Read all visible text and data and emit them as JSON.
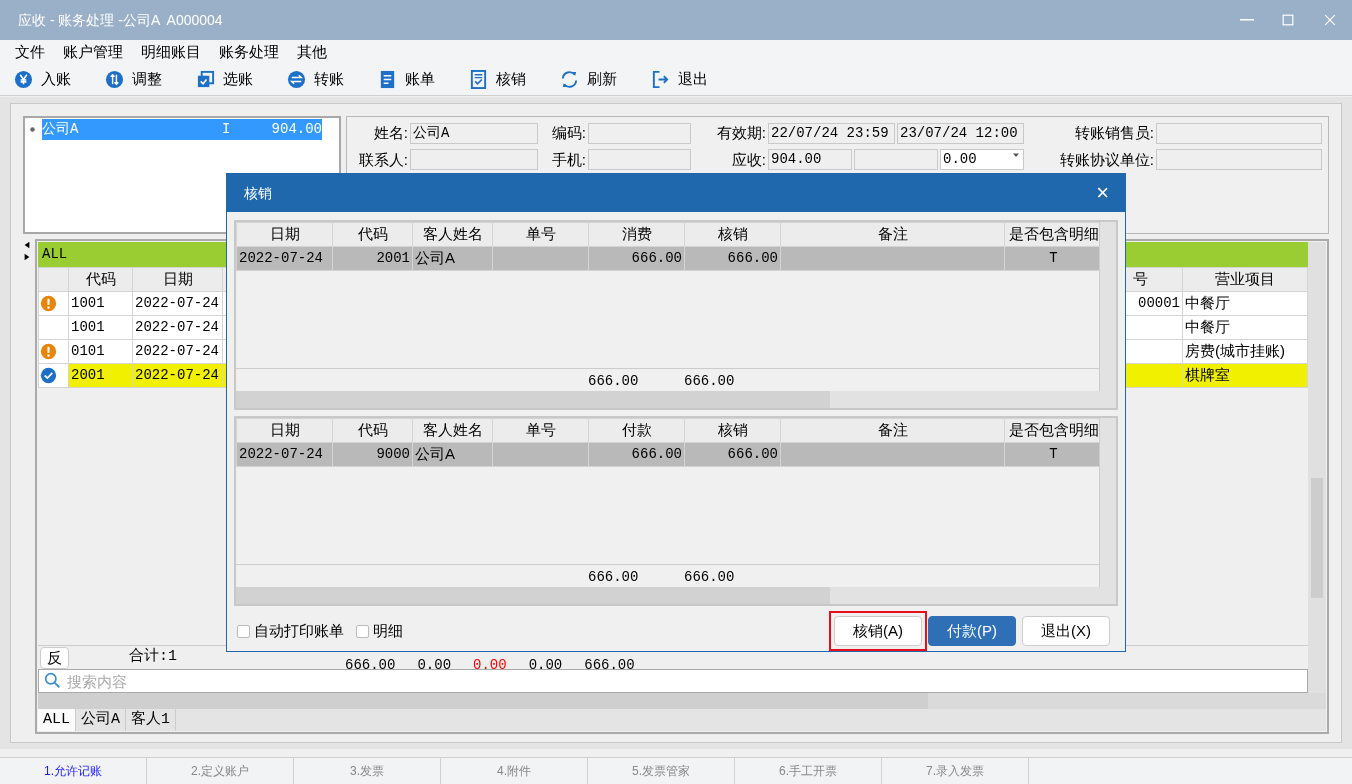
{
  "window": {
    "title": "应收 - 账务处理 -公司A  A000004"
  },
  "menu": [
    "文件",
    "账户管理",
    "明细账目",
    "账务处理",
    "其他"
  ],
  "toolbar": [
    {
      "label": "入账",
      "kind": "yen"
    },
    {
      "label": "调整",
      "kind": "updown"
    },
    {
      "label": "选账",
      "kind": "copy"
    },
    {
      "label": "转账",
      "kind": "swap"
    },
    {
      "label": "账单",
      "kind": "doc"
    },
    {
      "label": "核销",
      "kind": "doccheck"
    },
    {
      "label": "刷新",
      "kind": "refresh"
    },
    {
      "label": "退出",
      "kind": "exit"
    }
  ],
  "account_list": [
    {
      "name": "公司A",
      "flag": "I",
      "amount": "904.00",
      "selected": true
    }
  ],
  "form": [
    [
      {
        "label": "姓名:",
        "inputs": [
          {
            "kind": "text",
            "value": "公司A"
          }
        ]
      },
      {
        "label": "编码:",
        "inputs": [
          {
            "kind": "text"
          }
        ]
      },
      {
        "label": "有效期:",
        "inputs": [
          {
            "kind": "text",
            "value": "22/07/24 23:59"
          },
          {
            "kind": "text",
            "value": "23/07/24 12:00"
          }
        ]
      },
      {
        "label": "转账销售员:",
        "inputs": [
          {
            "kind": "text"
          }
        ]
      }
    ],
    [
      {
        "label": "联系人:",
        "inputs": [
          {
            "kind": "text"
          }
        ]
      },
      {
        "label": "手机:",
        "inputs": [
          {
            "kind": "text"
          }
        ]
      },
      {
        "label": "应收:",
        "inputs": [
          {
            "kind": "text",
            "value": "904.00"
          },
          {
            "kind": "text"
          },
          {
            "kind": "dropdown",
            "value": "0.00"
          }
        ]
      },
      {
        "label": "转账协议单位:",
        "inputs": [
          {
            "kind": "text"
          }
        ]
      }
    ]
  ],
  "grid": {
    "filter": "ALL",
    "columns": [
      "代码",
      "日期",
      "号",
      "营业项目"
    ],
    "rows": [
      {
        "kind": "warning",
        "code": "1001",
        "date": "2022-07-24",
        "number": "00001",
        "item": "中餐厅",
        "selected": false
      },
      {
        "kind": "plain",
        "code": "1001",
        "date": "2022-07-24",
        "item": "中餐厅",
        "selected": false
      },
      {
        "kind": "warning",
        "code": "0101",
        "date": "2022-07-24",
        "item": "房费(城市挂账)",
        "selected": false
      },
      {
        "kind": "done",
        "code": "2001",
        "date": "2022-07-24",
        "item": "棋牌室",
        "selected": true
      }
    ],
    "reverse_button": "反",
    "total_label": "合计:1",
    "totals": [
      {
        "value": "666.00",
        "color": "#000000"
      },
      {
        "value": "0.00",
        "color": "#000000"
      },
      {
        "value": "0.00",
        "color": "#ff0000"
      },
      {
        "value": "0.00",
        "color": "#000000"
      },
      {
        "value": "666.00",
        "color": "#000000"
      }
    ],
    "search": {
      "placeholder": "搜索内容"
    },
    "tabs": [
      {
        "label": "ALL",
        "selected": true
      },
      {
        "label": "公司A",
        "selected": false
      },
      {
        "label": "客人1",
        "selected": false
      }
    ]
  },
  "status_tabs": [
    {
      "label": "1.允许记账",
      "selected": true
    },
    {
      "label": "2.定义账户",
      "selected": false
    },
    {
      "label": "3.发票",
      "selected": false
    },
    {
      "label": "4.附件",
      "selected": false
    },
    {
      "label": "5.发票管家",
      "selected": false
    },
    {
      "label": "6.手工开票",
      "selected": false
    },
    {
      "label": "7.录入发票",
      "selected": false
    }
  ],
  "dialog": {
    "title": "核销",
    "close": "×",
    "tables": [
      {
        "columns": [
          "日期",
          "代码",
          "客人姓名",
          "单号",
          "消费",
          "核销",
          "备注",
          "是否包含明细"
        ],
        "rows": [
          {
            "date": "2022-07-24",
            "code": "2001",
            "guest": "公司A",
            "amount": "666.00",
            "writeoff": "666.00",
            "detail": "T",
            "selected": true
          }
        ],
        "totals": [
          {
            "value": "666.00"
          },
          {
            "value": "666.00"
          }
        ]
      },
      {
        "columns": [
          "日期",
          "代码",
          "客人姓名",
          "单号",
          "付款",
          "核销",
          "备注",
          "是否包含明细"
        ],
        "rows": [
          {
            "date": "2022-07-24",
            "code": "9000",
            "guest": "公司A",
            "amount": "666.00",
            "writeoff": "666.00",
            "detail": "T",
            "selected": true
          }
        ],
        "totals": [
          {
            "value": "666.00"
          },
          {
            "value": "666.00"
          }
        ]
      }
    ],
    "options": [
      {
        "label": "自动打印账单",
        "checked": false
      },
      {
        "label": "明细",
        "checked": false
      }
    ],
    "buttons": [
      {
        "label": "核销(A)",
        "kind": "default",
        "highlighted": true
      },
      {
        "label": "付款(P)",
        "kind": "primary",
        "highlighted": false
      },
      {
        "label": "退出(X)",
        "kind": "default",
        "highlighted": false
      }
    ]
  }
}
